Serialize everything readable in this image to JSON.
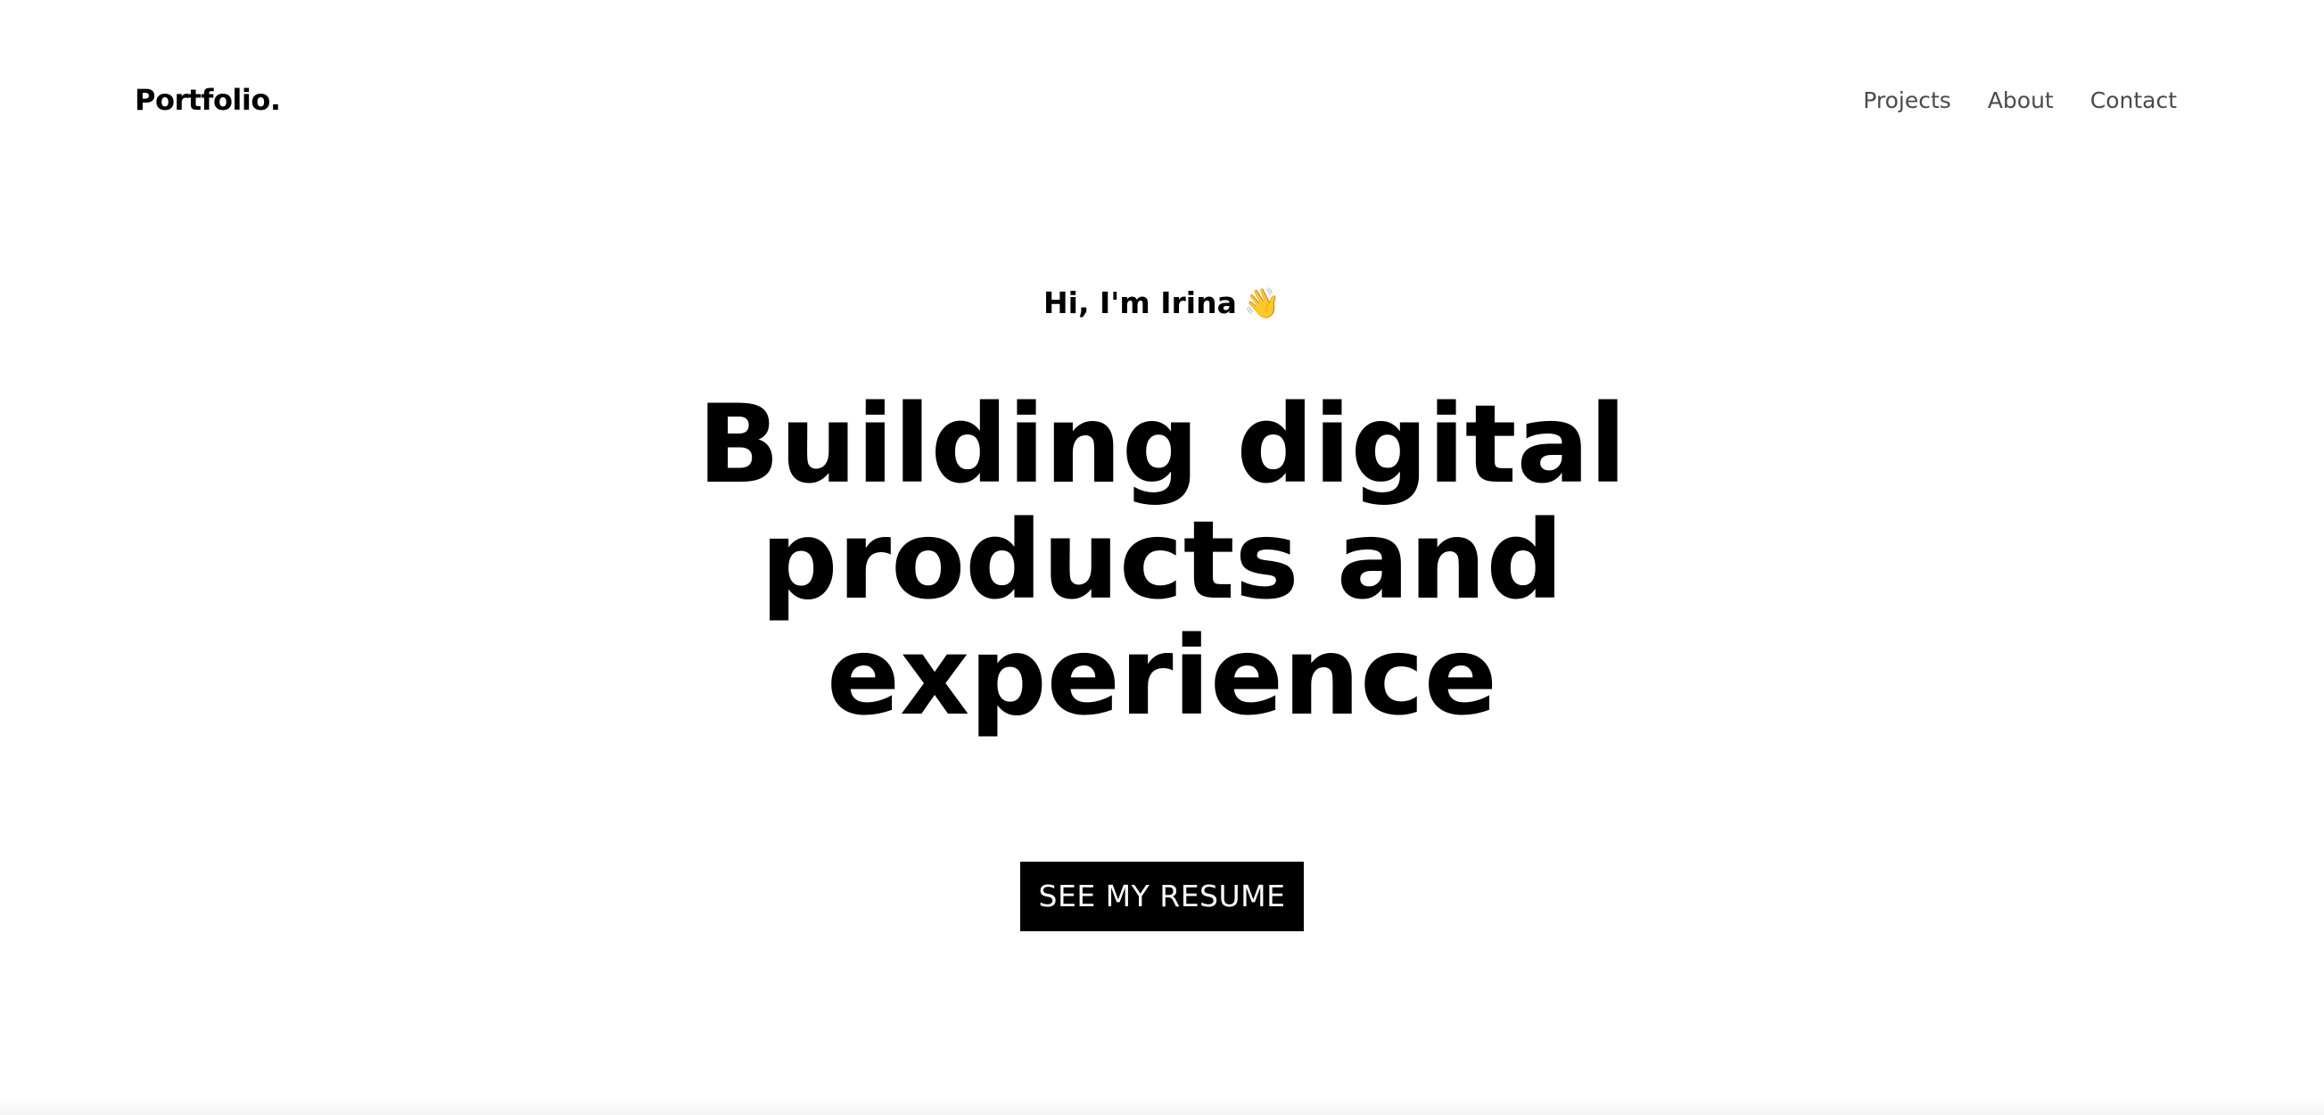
{
  "header": {
    "logo": "Portfolio.",
    "nav": [
      {
        "label": "Projects"
      },
      {
        "label": "About"
      },
      {
        "label": "Contact"
      }
    ]
  },
  "hero": {
    "greeting": "Hi, I'm Irina",
    "greeting_emoji": "👋",
    "headline_lines": [
      "Building digital",
      "products and",
      "experience"
    ],
    "cta_label": "SEE MY RESUME"
  },
  "colors": {
    "background": "#ffffff",
    "text": "#000000",
    "nav_text": "#4a4a4a",
    "cta_bg": "#000000",
    "cta_text": "#ffffff"
  }
}
